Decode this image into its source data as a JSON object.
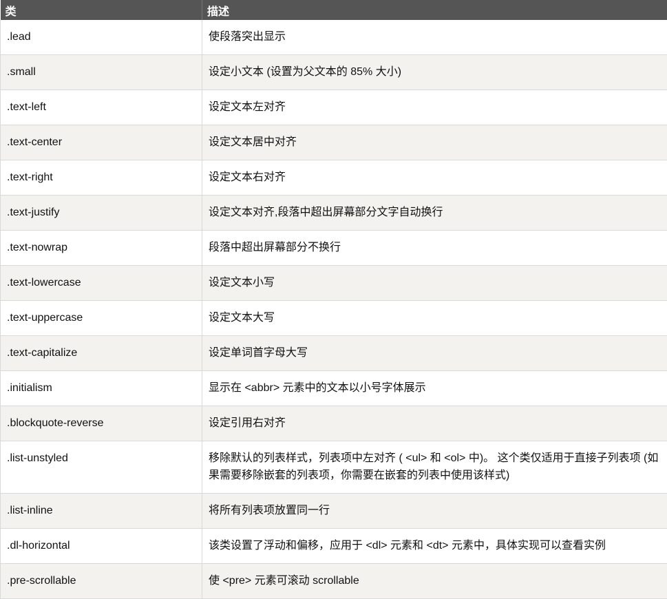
{
  "header": {
    "col_class": "类",
    "col_desc": "描述"
  },
  "rows": [
    {
      "cls": ".lead",
      "desc": "使段落突出显示"
    },
    {
      "cls": ".small",
      "desc": "设定小文本 (设置为父文本的 85% 大小)"
    },
    {
      "cls": ".text-left",
      "desc": "设定文本左对齐"
    },
    {
      "cls": ".text-center",
      "desc": "设定文本居中对齐"
    },
    {
      "cls": ".text-right",
      "desc": "设定文本右对齐"
    },
    {
      "cls": ".text-justify",
      "desc": "设定文本对齐,段落中超出屏幕部分文字自动换行"
    },
    {
      "cls": ".text-nowrap",
      "desc": "段落中超出屏幕部分不换行"
    },
    {
      "cls": ".text-lowercase",
      "desc": "设定文本小写"
    },
    {
      "cls": ".text-uppercase",
      "desc": "设定文本大写"
    },
    {
      "cls": ".text-capitalize",
      "desc": "设定单词首字母大写"
    },
    {
      "cls": ".initialism",
      "desc": "显示在 <abbr> 元素中的文本以小号字体展示"
    },
    {
      "cls": ".blockquote-reverse",
      "desc": "设定引用右对齐"
    },
    {
      "cls": ".list-unstyled",
      "desc": "移除默认的列表样式，列表项中左对齐 ( <ul> 和 <ol> 中)。 这个类仅适用于直接子列表项 (如果需要移除嵌套的列表项，你需要在嵌套的列表中使用该样式)"
    },
    {
      "cls": ".list-inline",
      "desc": "将所有列表项放置同一行"
    },
    {
      "cls": ".dl-horizontal",
      "desc": "该类设置了浮动和偏移，应用于 <dl> 元素和 <dt> 元素中，具体实现可以查看实例"
    },
    {
      "cls": ".pre-scrollable",
      "desc": "使 <pre> 元素可滚动 scrollable"
    }
  ]
}
